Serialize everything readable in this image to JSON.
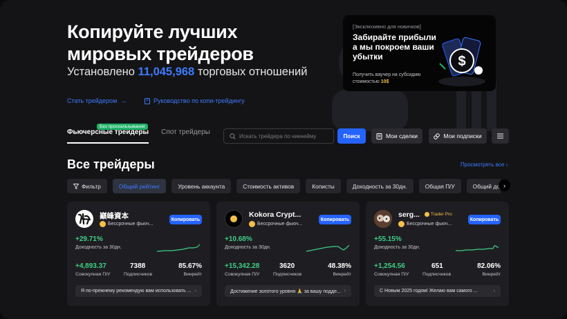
{
  "hero": {
    "title": "Копируйте лучших мировых трейдеров",
    "sub_prefix": "Установлено",
    "sub_count": "11,045,968",
    "sub_suffix": "торговых отношений",
    "link_become": "Стать трейдером",
    "link_guide": "Руководство по копи-трейдингу"
  },
  "promo": {
    "tag": "[Эксклюзивно для новичков]",
    "title": "Забирайте прибыли а мы покроем ваши убытки",
    "desc_prefix": "Получить ваучер на субсидию стоимостью",
    "desc_amount": "10$"
  },
  "tabs": {
    "futures": "Фьючерсные трейдеры",
    "futures_badge": "Без проскальзывания",
    "spot": "Спот трейдеры"
  },
  "toolbar": {
    "search_placeholder": "Искать трейдера по никнейму",
    "search_button": "Поиск",
    "my_deals": "Мои сделки",
    "my_subs": "Мои подписки"
  },
  "section": {
    "title": "Все трейдеры",
    "view_all": "Просмотреть все"
  },
  "filters": [
    "Фильтр",
    "Общий рейтинг",
    "Уровень аккаунта",
    "Стоимость активов",
    "Кописты",
    "Доходность за 30дн.",
    "Общая П/У",
    "Общий доход"
  ],
  "cards": [
    {
      "name": "巓峰資本",
      "subtitle": "Бессрочные фьюч...",
      "copy": "Копировать",
      "pct": "+29.71%",
      "pct_label": "Доходность за 30дн.",
      "pnl": "+4,893.37",
      "pnl_label": "Совокупная П/У",
      "subs": "7388",
      "subs_label": "Подписчиков",
      "winrate": "85.67%",
      "winrate_label": "Винрейт",
      "message": "Я по-прежнему рекомендую вам использовать ..."
    },
    {
      "name": "Kokora Crypt...",
      "subtitle": "Бессрочные фьюч...",
      "copy": "Копировать",
      "pct": "+10.68%",
      "pct_label": "Доходность за 30дн.",
      "pnl": "+15,342.28",
      "pnl_label": "Совокупная П/У",
      "subs": "3620",
      "subs_label": "Подписчиков",
      "winrate": "48.38%",
      "winrate_label": "Винрейт",
      "message": "Достижение золотого уровня 🙏 за вашу подде..."
    },
    {
      "name": "serg...",
      "badge": "Trader Pro",
      "subtitle": "Бессрочные фьюч...",
      "copy": "Копировать",
      "pct": "+55.15%",
      "pct_label": "Доходность за 30дн.",
      "pnl": "+1,254.56",
      "pnl_label": "Совокупная П/У",
      "subs": "651",
      "subs_label": "Подписчиков",
      "winrate": "82.06%",
      "winrate_label": "Винрейт",
      "message": "С Новым 2025 годом! Желаю вам самого ..."
    }
  ]
}
